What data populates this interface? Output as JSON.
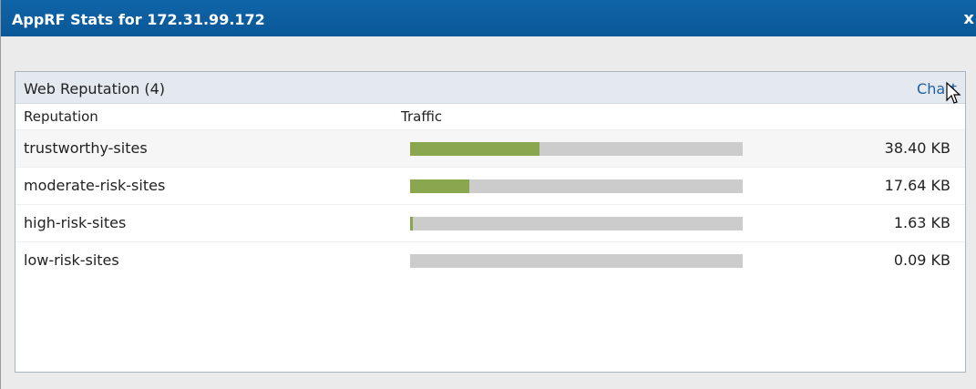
{
  "window": {
    "title": "AppRF Stats for 172.31.99.172",
    "close_label": "x"
  },
  "panel": {
    "title": "Web Reputation (4)",
    "chart_link": "Chart",
    "columns": {
      "reputation": "Reputation",
      "traffic": "Traffic"
    },
    "rows": [
      {
        "name": "trustworthy-sites",
        "value": "38.40 KB",
        "fill_fraction": 0.39
      },
      {
        "name": "moderate-risk-sites",
        "value": "17.64 KB",
        "fill_fraction": 0.177
      },
      {
        "name": "high-risk-sites",
        "value": "1.63 KB",
        "fill_fraction": 0.008
      },
      {
        "name": "low-risk-sites",
        "value": "0.09 KB",
        "fill_fraction": 0.0
      }
    ]
  },
  "colors": {
    "titlebar": "#0a5898",
    "bar_fill": "#8aa64e",
    "bar_track": "#cccccc",
    "link": "#1f5f9e"
  }
}
